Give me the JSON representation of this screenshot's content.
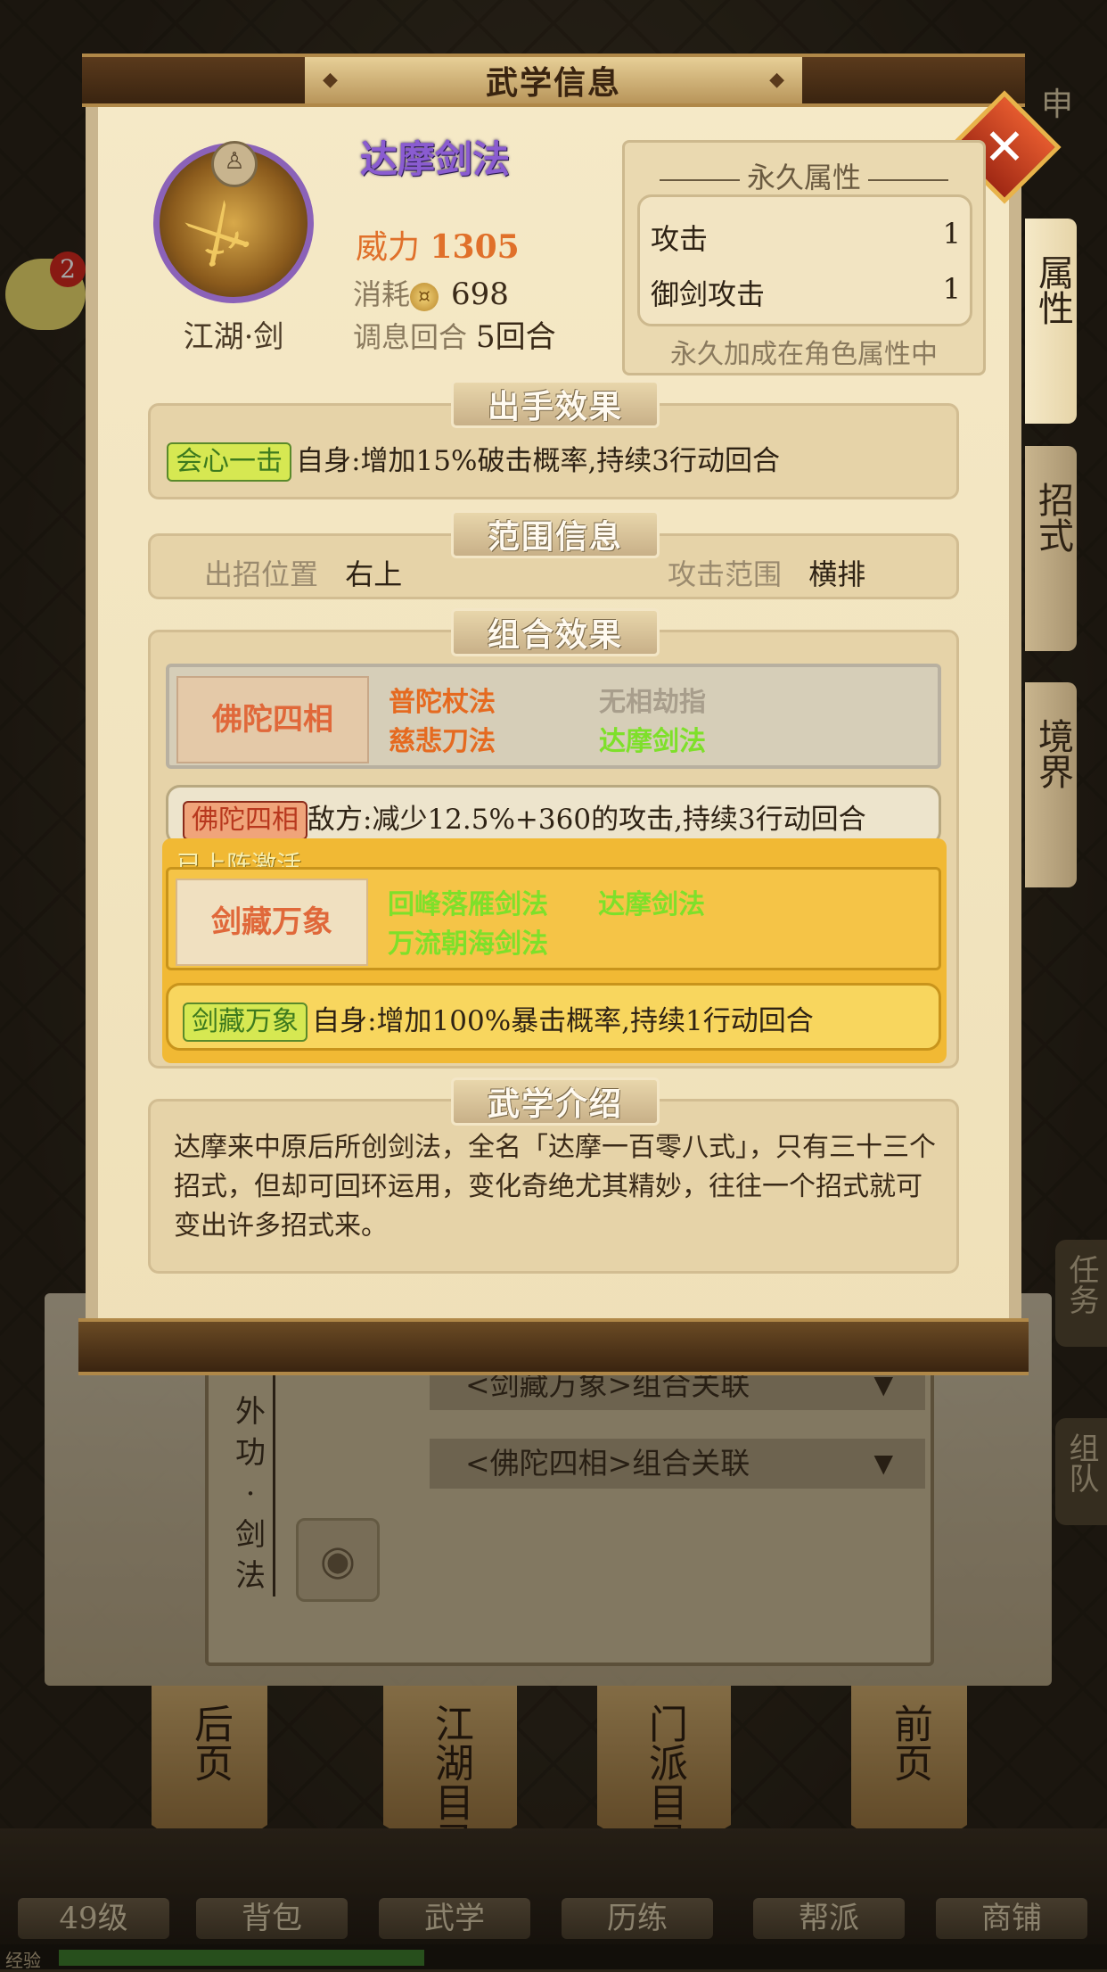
{
  "background": {
    "combo_links": [
      "<剑藏万象>组合关联",
      "<佛陀四相>组合关联"
    ],
    "vertical_label": [
      "外",
      "功",
      "·",
      "剑",
      "法"
    ],
    "bottom_tabs": [
      "后页",
      "江湖目录",
      "门派目录",
      "前页"
    ],
    "bottom_menu": [
      "49级",
      "背包",
      "武学",
      "历练",
      "帮派",
      "商铺"
    ],
    "exp_label": "经验",
    "exp_progress": 0.35,
    "chat_badge": "2",
    "right_side_tags": [
      "任务",
      "组队"
    ],
    "top_right_char": "申"
  },
  "dialog": {
    "title": "武学信息",
    "close_icon": "close-icon",
    "side_tabs": [
      "属性",
      "招式",
      "境界"
    ],
    "skill": {
      "name": "达摩剑法",
      "category": "江湖·剑",
      "power_label": "威力",
      "power_value": "1305",
      "cost_label": "消耗",
      "cost_value": "698",
      "round_label": "调息回合",
      "round_value": "5回合"
    },
    "permanent_attrs": {
      "title": "永久属性",
      "rows": [
        {
          "name": "攻击",
          "value": "1"
        },
        {
          "name": "御剑攻击",
          "value": "1"
        }
      ],
      "note": "永久加成在角色属性中"
    },
    "action_effect": {
      "title": "出手效果",
      "tag": "会心一击",
      "text": "自身:增加15%破击概率,持续3行动回合"
    },
    "range_info": {
      "title": "范围信息",
      "position_label": "出招位置",
      "position_value": "右上",
      "range_label": "攻击范围",
      "range_value": "横排"
    },
    "combo_effect": {
      "title": "组合效果",
      "combo1": {
        "name": "佛陀四相",
        "skills": [
          "普陀杖法",
          "无相劫指",
          "慈悲刀法",
          "达摩剑法"
        ],
        "effect_tag": "佛陀四相",
        "effect_text": "敌方:减少12.5%+360的攻击,持续3行动回合"
      },
      "combo2": {
        "status": "已上阵激活",
        "name": "剑藏万象",
        "skills": [
          "回峰落雁剑法",
          "达摩剑法",
          "万流朝海剑法"
        ],
        "effect_tag": "剑藏万象",
        "effect_text": "自身:增加100%暴击概率,持续1行动回合"
      }
    },
    "intro": {
      "title": "武学介绍",
      "text": "达摩来中原后所创剑法，全名「达摩一百零八式」，只有三十三个招式，但却可回环运用，变化奇绝尤其精妙，往往一个招式就可变出许多招式来。"
    }
  }
}
